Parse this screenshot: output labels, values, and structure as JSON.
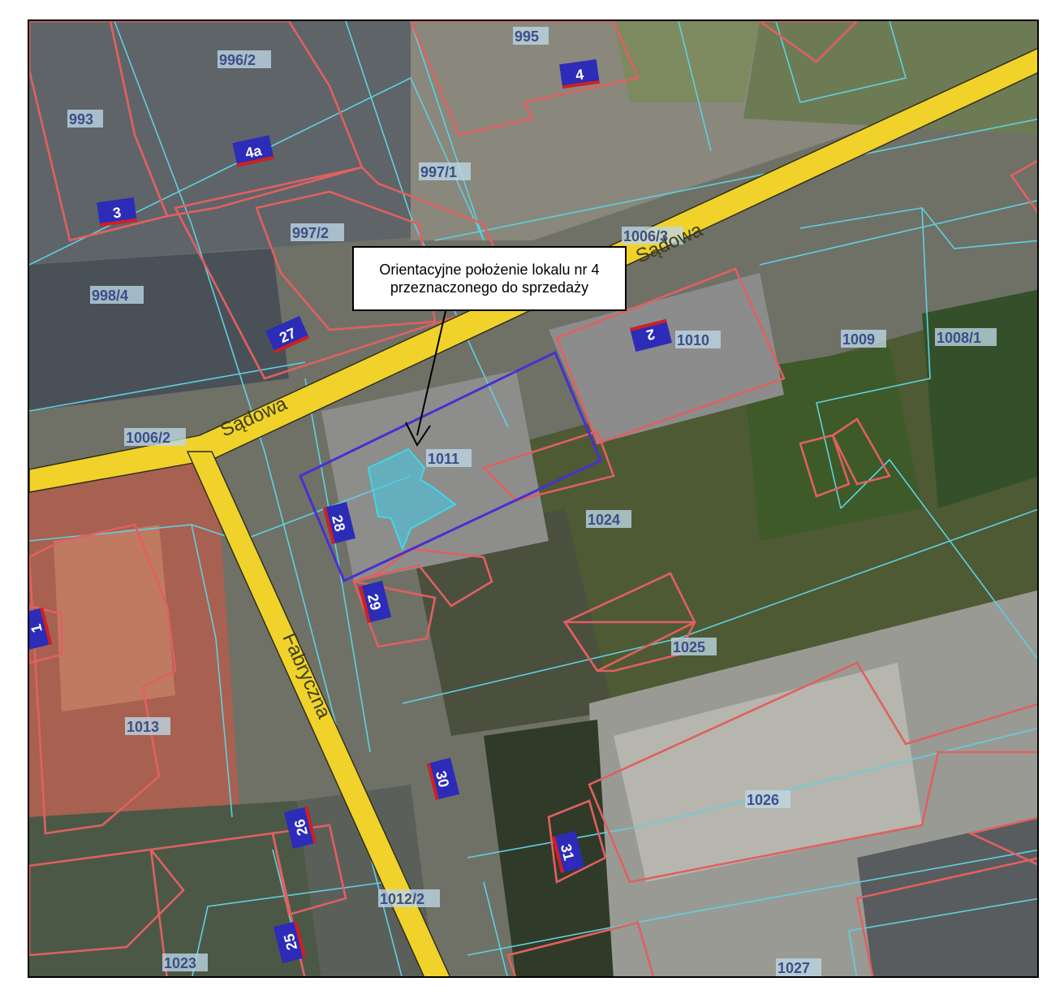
{
  "callout": {
    "line1": "Orientacyjne położenie lokalu nr 4",
    "line2": "przeznaczonego do sprzedaży"
  },
  "streets": {
    "sadowa_1": "Sądowa",
    "sadowa_2": "Sądowa",
    "fabryczna": "Fabryczna"
  },
  "parcels": {
    "p993": "993",
    "p995": "995",
    "p996_2": "996/2",
    "p997_1": "997/1",
    "p997_2": "997/2",
    "p998_4": "998/4",
    "p1006_2": "1006/2",
    "p1006_3": "1006/3",
    "p1008_1": "1008/1",
    "p1009": "1009",
    "p1010": "1010",
    "p1011": "1011",
    "p1012_2": "1012/2",
    "p1013": "1013",
    "p1023": "1023",
    "p1024": "1024",
    "p1025": "1025",
    "p1026": "1026",
    "p1027": "1027"
  },
  "house_numbers": {
    "h1": "1",
    "h2": "2",
    "h3": "3",
    "h4": "4",
    "h4a": "4a",
    "h25": "25",
    "h26": "26",
    "h27": "27",
    "h28": "28",
    "h29": "29",
    "h30": "30",
    "h31": "31"
  },
  "colors": {
    "road": "#f0d22a",
    "building_outline": "#e06060",
    "parcel_line": "#5fd0e0",
    "highlight_parcel": "#4a2fd0",
    "highlight_unit": "#3fd8e8",
    "house_badge": "#2c2cb8",
    "house_badge_accent": "#d02020"
  }
}
